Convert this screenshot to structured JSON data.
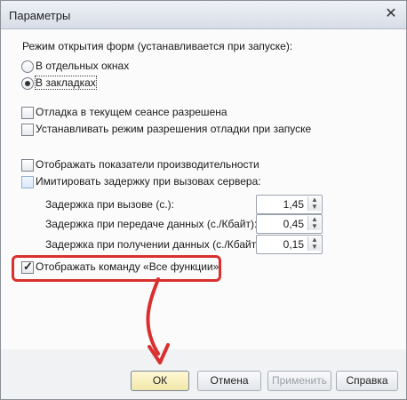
{
  "window": {
    "title": "Параметры"
  },
  "form_open_mode": {
    "heading": "Режим открытия форм (устанавливается при запуске):",
    "options": [
      {
        "label": "В отдельных окнах",
        "selected": false
      },
      {
        "label": "В закладках",
        "selected": true
      }
    ]
  },
  "debug": {
    "allowed_label": "Отладка в текущем сеансе разрешена",
    "set_on_start_label": "Устанавливать режим разрешения отладки при запуске"
  },
  "performance": {
    "show_metrics_label": "Отображать показатели производительности",
    "simulate_delay_label": "Имитировать задержку при вызовах сервера:",
    "call_delay_label": "Задержка при вызове (с.):",
    "call_delay_value": "1,45",
    "send_delay_label": "Задержка при передаче данных (с./Кбайт):",
    "send_delay_value": "0,45",
    "receive_delay_label": "Задержка при получении данных (с./Кбайт):",
    "receive_delay_value": "0,15"
  },
  "all_functions": {
    "label": "Отображать команду «Все функции»",
    "checked": true
  },
  "buttons": {
    "ok": "ОК",
    "cancel": "Отмена",
    "apply": "Применить",
    "help": "Справка"
  },
  "annotation_color": "#d9302f"
}
